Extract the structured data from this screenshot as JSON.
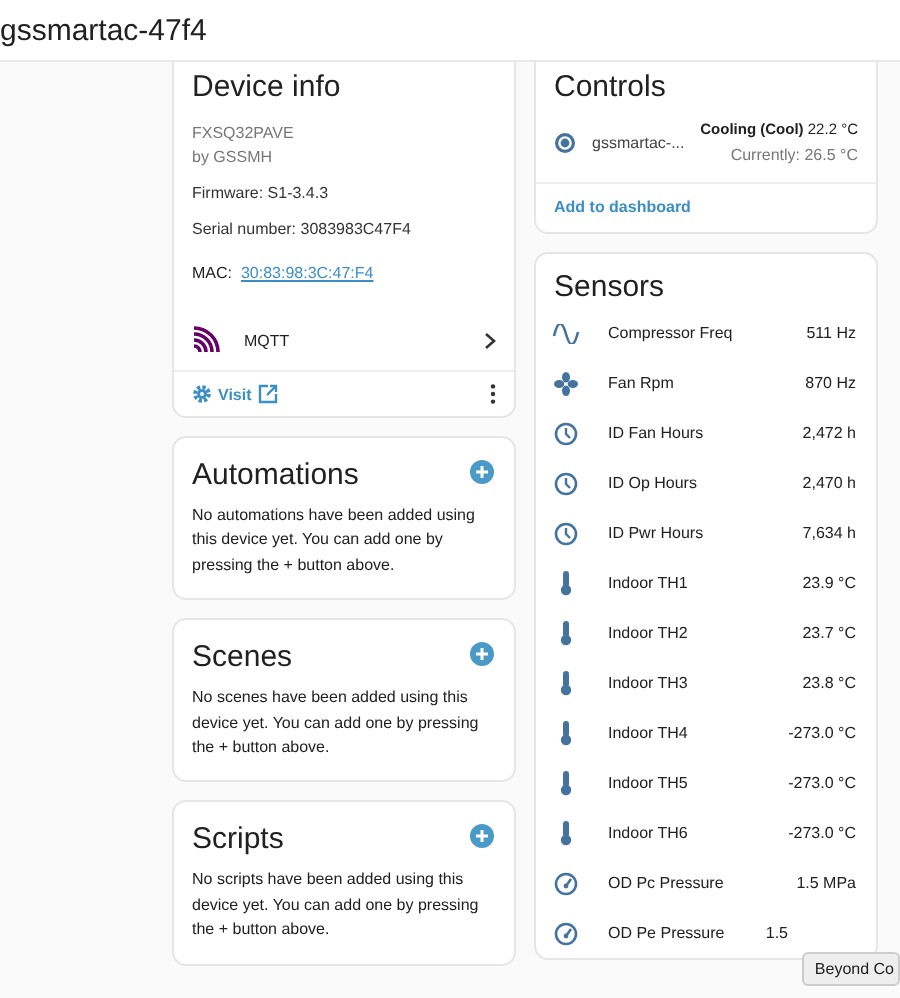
{
  "header": {
    "title": "gssmartac-47f4"
  },
  "device_info": {
    "title": "Device info",
    "model": "FXSQ32PAVE",
    "manufacturer": "by GSSMH",
    "firmware": "Firmware: S1-3.4.3",
    "serial": "Serial number: 3083983C47F4",
    "mac_label": "MAC:",
    "mac": "30:83:98:3C:47:F4",
    "integration": "MQTT",
    "visit": "Visit"
  },
  "sections": [
    {
      "title": "Automations",
      "text": "No automations have been added using this device yet. You can add one by pressing the + button above."
    },
    {
      "title": "Scenes",
      "text": "No scenes have been added using this device yet. You can add one by pressing the + button above."
    },
    {
      "title": "Scripts",
      "text": "No scripts have been added using this device yet. You can add one by pressing the + button above."
    }
  ],
  "controls": {
    "title": "Controls",
    "entity": "gssmartac-...",
    "state_bold": "Cooling (Cool)",
    "state": "22.2 °C",
    "current": "Currently: 26.5 °C",
    "add": "Add to dashboard"
  },
  "sensors": {
    "title": "Sensors",
    "rows": [
      {
        "kind": "wave",
        "name": "Compressor Freq",
        "value": "511 Hz"
      },
      {
        "kind": "fan",
        "name": "Fan Rpm",
        "value": "870 Hz"
      },
      {
        "kind": "clock",
        "name": "ID Fan Hours",
        "value": "2,472 h"
      },
      {
        "kind": "clock",
        "name": "ID Op Hours",
        "value": "2,470 h"
      },
      {
        "kind": "clock",
        "name": "ID Pwr Hours",
        "value": "7,634 h"
      },
      {
        "kind": "thermometer",
        "name": "Indoor TH1",
        "value": "23.9 °C"
      },
      {
        "kind": "thermometer",
        "name": "Indoor TH2",
        "value": "23.7 °C"
      },
      {
        "kind": "thermometer",
        "name": "Indoor TH3",
        "value": "23.8 °C"
      },
      {
        "kind": "thermometer",
        "name": "Indoor TH4",
        "value": "-273.0 °C"
      },
      {
        "kind": "thermometer",
        "name": "Indoor TH5",
        "value": "-273.0 °C"
      },
      {
        "kind": "thermometer",
        "name": "Indoor TH6",
        "value": "-273.0 °C"
      },
      {
        "kind": "gauge",
        "name": "OD Pc Pressure",
        "value": "1.5 MPa"
      },
      {
        "kind": "gauge",
        "name": "OD Pe Pressure",
        "value": "1.5"
      }
    ]
  },
  "tooltip": "Beyond Co"
}
